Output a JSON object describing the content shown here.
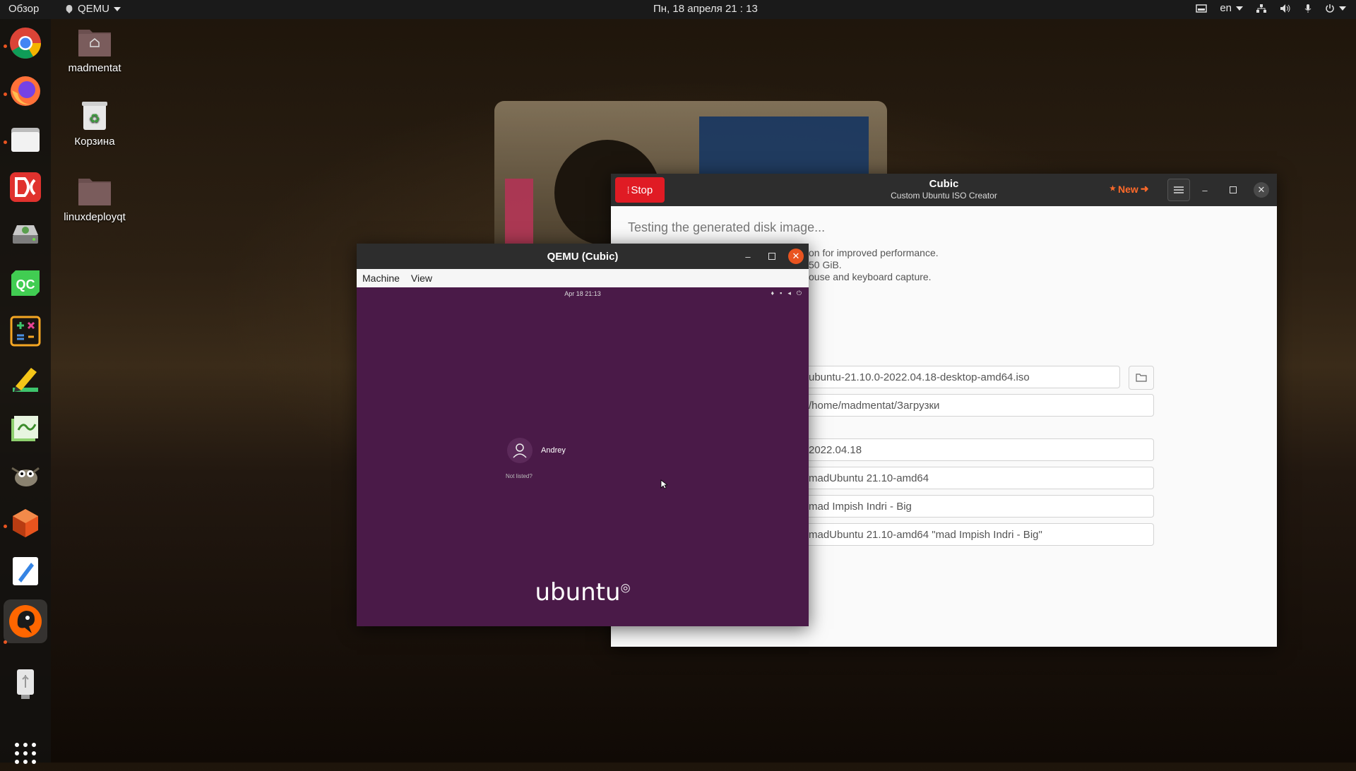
{
  "topbar": {
    "activities": "Обзор",
    "app_name": "QEMU",
    "clock": "Пн, 18 апреля  21 : 13",
    "keyboard_layout": "en"
  },
  "desktop": {
    "icons": [
      {
        "label": "madmentat",
        "icon": "home-folder-icon"
      },
      {
        "label": "Корзина",
        "icon": "trash-icon"
      },
      {
        "label": "linuxdeployqt",
        "icon": "folder-icon"
      }
    ]
  },
  "dock": {
    "apps": [
      "chrome-icon",
      "firefox-icon",
      "files-icon",
      "dropbox-icon",
      "disk-icon",
      "qtcreator-icon",
      "calculator-icon",
      "editor-icon",
      "kate-icon",
      "gimp-icon",
      "cubic-icon",
      "text-editor-icon",
      "qemu-icon",
      "usb-icon"
    ],
    "show_apps": "apps-grid-icon"
  },
  "cubic": {
    "stop_label": "Stop",
    "title": "Cubic",
    "subtitle": "Custom Ubuntu ISO Creator",
    "new_label": "New",
    "heading": "Testing the generated disk image...",
    "info_lines": [
      "on for improved performance.",
      "50 GiB.",
      "ouse and keyboard capture."
    ],
    "fields": [
      "ubuntu-21.10.0-2022.04.18-desktop-amd64.iso",
      "/home/madmentat/Загрузки",
      "2022.04.18",
      "madUbuntu 21.10-amd64",
      "mad Impish Indri  - Big",
      "madUbuntu 21.10-amd64 \"mad Impish Indri  - Big\""
    ],
    "accent_color": "#e01b24"
  },
  "qemu": {
    "title": "QEMU (Cubic)",
    "menu": [
      "Machine",
      "View"
    ],
    "guest": {
      "clock": "Apr 18  21:13",
      "user": "Andrey",
      "not_listed": "Not listed?",
      "logo": "ubuntu",
      "bg_color": "#4a1a48"
    }
  }
}
